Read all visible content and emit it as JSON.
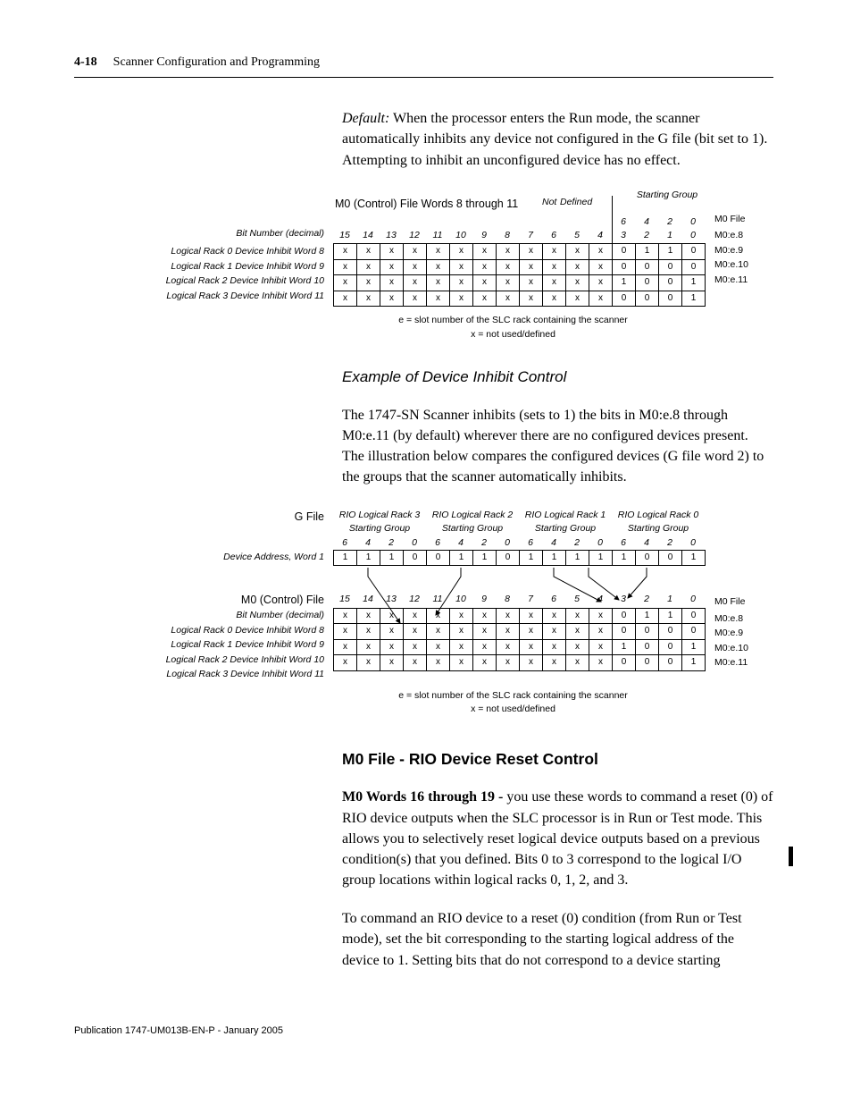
{
  "header": {
    "page": "4-18",
    "chapter": "Scanner Configuration and Programming"
  },
  "intro": {
    "label": "Default:",
    "text": " When the processor enters the Run mode, the scanner automatically inhibits any device not configured in the G file (bit set to 1). Attempting to inhibit an unconfigured device has no effect."
  },
  "fig1": {
    "title": "M0 (Control) File Words 8 through 11",
    "notdef": "Not",
    "notdef2": "Defined",
    "bitlabel": "Bit Number (decimal)",
    "startgrp": "Starting Group",
    "sg": [
      "6",
      "4",
      "2",
      "0"
    ],
    "bits": [
      "15",
      "14",
      "13",
      "12",
      "11",
      "10",
      "9",
      "8",
      "7",
      "6",
      "5",
      "4",
      "3",
      "2",
      "1",
      "0"
    ],
    "rowlabels": [
      "Logical Rack 0 Device Inhibit Word 8",
      "Logical Rack 1 Device Inhibit Word 9",
      "Logical Rack 2 Device Inhibit Word 10",
      "Logical Rack 3 Device Inhibit Word 11"
    ],
    "m0file": "M0 File",
    "m0right": [
      "M0:e.8",
      "M0:e.9",
      "M0:e.10",
      "M0:e.11"
    ],
    "data": [
      [
        "x",
        "x",
        "x",
        "x",
        "x",
        "x",
        "x",
        "x",
        "x",
        "x",
        "x",
        "x",
        "0",
        "1",
        "1",
        "0"
      ],
      [
        "x",
        "x",
        "x",
        "x",
        "x",
        "x",
        "x",
        "x",
        "x",
        "x",
        "x",
        "x",
        "0",
        "0",
        "0",
        "0"
      ],
      [
        "x",
        "x",
        "x",
        "x",
        "x",
        "x",
        "x",
        "x",
        "x",
        "x",
        "x",
        "x",
        "1",
        "0",
        "0",
        "1"
      ],
      [
        "x",
        "x",
        "x",
        "x",
        "x",
        "x",
        "x",
        "x",
        "x",
        "x",
        "x",
        "x",
        "0",
        "0",
        "0",
        "1"
      ]
    ],
    "legend1": "e = slot number of the SLC rack containing the scanner",
    "legend2": "x = not used/defined"
  },
  "example": {
    "heading": "Example of Device Inhibit Control",
    "text": "The 1747-SN Scanner inhibits (sets to 1) the bits in M0:e.8 through M0:e.11 (by default) wherever there are no configured devices present. The illustration below compares the configured devices (G file word 2) to the groups that the scanner automatically inhibits."
  },
  "fig2": {
    "gfile": "G File",
    "devaddr": "Device  Address, Word 1",
    "m0ctrl": "M0 (Control) File",
    "bitlabel": "Bit Number (decimal)",
    "riohdr": [
      "RIO Logical Rack 3",
      "RIO Logical Rack 2",
      "RIO Logical Rack 1",
      "RIO Logical Rack 0"
    ],
    "riosub": "Starting Group",
    "sg": [
      "6",
      "4",
      "2",
      "0",
      "6",
      "4",
      "2",
      "0",
      "6",
      "4",
      "2",
      "0",
      "6",
      "4",
      "2",
      "0"
    ],
    "gdata": [
      "1",
      "1",
      "1",
      "0",
      "0",
      "1",
      "1",
      "0",
      "1",
      "1",
      "1",
      "1",
      "1",
      "0",
      "0",
      "1"
    ],
    "bits": [
      "15",
      "14",
      "13",
      "12",
      "11",
      "10",
      "9",
      "8",
      "7",
      "6",
      "5",
      "4",
      "3",
      "2",
      "1",
      "0"
    ],
    "rowlabels": [
      "Logical Rack 0 Device Inhibit Word 8",
      "Logical Rack 1 Device Inhibit Word 9",
      "Logical Rack 2 Device Inhibit Word 10",
      "Logical Rack 3 Device Inhibit Word 11"
    ],
    "m0file": "M0 File",
    "m0right": [
      "M0:e.8",
      "M0:e.9",
      "M0:e.10",
      "M0:e.11"
    ],
    "data": [
      [
        "x",
        "x",
        "x",
        "x",
        "x",
        "x",
        "x",
        "x",
        "x",
        "x",
        "x",
        "x",
        "0",
        "1",
        "1",
        "0"
      ],
      [
        "x",
        "x",
        "x",
        "x",
        "x",
        "x",
        "x",
        "x",
        "x",
        "x",
        "x",
        "x",
        "0",
        "0",
        "0",
        "0"
      ],
      [
        "x",
        "x",
        "x",
        "x",
        "x",
        "x",
        "x",
        "x",
        "x",
        "x",
        "x",
        "x",
        "1",
        "0",
        "0",
        "1"
      ],
      [
        "x",
        "x",
        "x",
        "x",
        "x",
        "x",
        "x",
        "x",
        "x",
        "x",
        "x",
        "x",
        "0",
        "0",
        "0",
        "1"
      ]
    ],
    "legend1": "e = slot number of the SLC rack containing the scanner",
    "legend2": "x = not used/defined"
  },
  "sec2": {
    "heading": "M0 File - RIO Device Reset Control",
    "label": "M0 Words 16 through 19 - ",
    "p1": "you use these words to command a reset (0) of RIO device outputs when the SLC processor is in Run or Test mode. This allows you to selectively reset logical device outputs based on a previous condition(s) that you defined. Bits 0 to 3 correspond to the logical I/O group locations within logical racks 0, 1, 2, and 3.",
    "p2": "To command an RIO device to a reset (0) condition (from Run or Test mode), set the bit corresponding to the starting logical address of the device to 1. Setting bits that do not correspond to a device starting"
  },
  "footer": "Publication 1747-UM013B-EN-P - January 2005",
  "chart_data": [
    {
      "type": "table",
      "title": "M0 (Control) File Words 8 through 11",
      "columns": [
        "15",
        "14",
        "13",
        "12",
        "11",
        "10",
        "9",
        "8",
        "7",
        "6",
        "5",
        "4",
        "3",
        "2",
        "1",
        "0"
      ],
      "rows": [
        "Logical Rack 0 Device Inhibit Word 8",
        "Logical Rack 1 Device Inhibit Word 9",
        "Logical Rack 2 Device Inhibit Word 10",
        "Logical Rack 3 Device Inhibit Word 11"
      ],
      "values": [
        [
          "x",
          "x",
          "x",
          "x",
          "x",
          "x",
          "x",
          "x",
          "x",
          "x",
          "x",
          "x",
          "0",
          "1",
          "1",
          "0"
        ],
        [
          "x",
          "x",
          "x",
          "x",
          "x",
          "x",
          "x",
          "x",
          "x",
          "x",
          "x",
          "x",
          "0",
          "0",
          "0",
          "0"
        ],
        [
          "x",
          "x",
          "x",
          "x",
          "x",
          "x",
          "x",
          "x",
          "x",
          "x",
          "x",
          "x",
          "1",
          "0",
          "0",
          "1"
        ],
        [
          "x",
          "x",
          "x",
          "x",
          "x",
          "x",
          "x",
          "x",
          "x",
          "x",
          "x",
          "x",
          "0",
          "0",
          "0",
          "1"
        ]
      ],
      "right_labels": [
        "M0:e.8",
        "M0:e.9",
        "M0:e.10",
        "M0:e.11"
      ]
    },
    {
      "type": "table",
      "title": "G File Device Address, Word 1",
      "columns": [
        "6",
        "4",
        "2",
        "0",
        "6",
        "4",
        "2",
        "0",
        "6",
        "4",
        "2",
        "0",
        "6",
        "4",
        "2",
        "0"
      ],
      "groups": [
        "RIO Logical Rack 3 Starting Group",
        "RIO Logical Rack 2 Starting Group",
        "RIO Logical Rack 1 Starting Group",
        "RIO Logical Rack 0 Starting Group"
      ],
      "values": [
        [
          "1",
          "1",
          "1",
          "0",
          "0",
          "1",
          "1",
          "0",
          "1",
          "1",
          "1",
          "1",
          "1",
          "0",
          "0",
          "1"
        ]
      ]
    },
    {
      "type": "table",
      "title": "M0 (Control) File (Example)",
      "columns": [
        "15",
        "14",
        "13",
        "12",
        "11",
        "10",
        "9",
        "8",
        "7",
        "6",
        "5",
        "4",
        "3",
        "2",
        "1",
        "0"
      ],
      "rows": [
        "Logical Rack 0 Device Inhibit Word 8",
        "Logical Rack 1 Device Inhibit Word 9",
        "Logical Rack 2 Device Inhibit Word 10",
        "Logical Rack 3 Device Inhibit Word 11"
      ],
      "values": [
        [
          "x",
          "x",
          "x",
          "x",
          "x",
          "x",
          "x",
          "x",
          "x",
          "x",
          "x",
          "x",
          "0",
          "1",
          "1",
          "0"
        ],
        [
          "x",
          "x",
          "x",
          "x",
          "x",
          "x",
          "x",
          "x",
          "x",
          "x",
          "x",
          "x",
          "0",
          "0",
          "0",
          "0"
        ],
        [
          "x",
          "x",
          "x",
          "x",
          "x",
          "x",
          "x",
          "x",
          "x",
          "x",
          "x",
          "x",
          "1",
          "0",
          "0",
          "1"
        ],
        [
          "x",
          "x",
          "x",
          "x",
          "x",
          "x",
          "x",
          "x",
          "x",
          "x",
          "x",
          "x",
          "0",
          "0",
          "0",
          "1"
        ]
      ],
      "right_labels": [
        "M0:e.8",
        "M0:e.9",
        "M0:e.10",
        "M0:e.11"
      ]
    }
  ]
}
